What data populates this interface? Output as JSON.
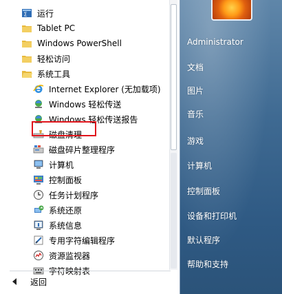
{
  "left": {
    "items": [
      {
        "label": "运行",
        "icon": "run-icon",
        "level": 0
      },
      {
        "label": "Tablet PC",
        "icon": "folder-icon",
        "level": 0
      },
      {
        "label": "Windows PowerShell",
        "icon": "folder-icon",
        "level": 0
      },
      {
        "label": "轻松访问",
        "icon": "folder-icon",
        "level": 0
      },
      {
        "label": "系统工具",
        "icon": "folder-icon",
        "level": 0
      },
      {
        "label": "Internet Explorer (无加载项)",
        "icon": "internet-explorer-icon",
        "level": 1
      },
      {
        "label": "Windows 轻松传送",
        "icon": "easy-transfer-icon",
        "level": 1
      },
      {
        "label": "Windows 轻松传送报告",
        "icon": "easy-transfer-report-icon",
        "level": 1
      },
      {
        "label": "磁盘清理",
        "icon": "disk-cleanup-icon",
        "level": 1
      },
      {
        "label": "磁盘碎片整理程序",
        "icon": "defragmenter-icon",
        "level": 1
      },
      {
        "label": "计算机",
        "icon": "computer-icon",
        "level": 1
      },
      {
        "label": "控制面板",
        "icon": "control-panel-icon",
        "level": 1
      },
      {
        "label": "任务计划程序",
        "icon": "task-scheduler-icon",
        "level": 1
      },
      {
        "label": "系统还原",
        "icon": "system-restore-icon",
        "level": 1
      },
      {
        "label": "系统信息",
        "icon": "system-info-icon",
        "level": 1
      },
      {
        "label": "专用字符编辑程序",
        "icon": "private-char-editor-icon",
        "level": 1
      },
      {
        "label": "资源监视器",
        "icon": "resource-monitor-icon",
        "level": 1
      },
      {
        "label": "字符映射表",
        "icon": "character-map-icon",
        "level": 1
      }
    ],
    "back_label": "返回"
  },
  "right": {
    "items": [
      "Administrator",
      "文档",
      "图片",
      "音乐",
      "游戏",
      "计算机",
      "控制面板",
      "设备和打印机",
      "默认程序",
      "帮助和支持"
    ]
  },
  "colors": {
    "highlight": "#e0141b",
    "right_pane": "#3f6a92",
    "folder": "#e7b93c"
  }
}
